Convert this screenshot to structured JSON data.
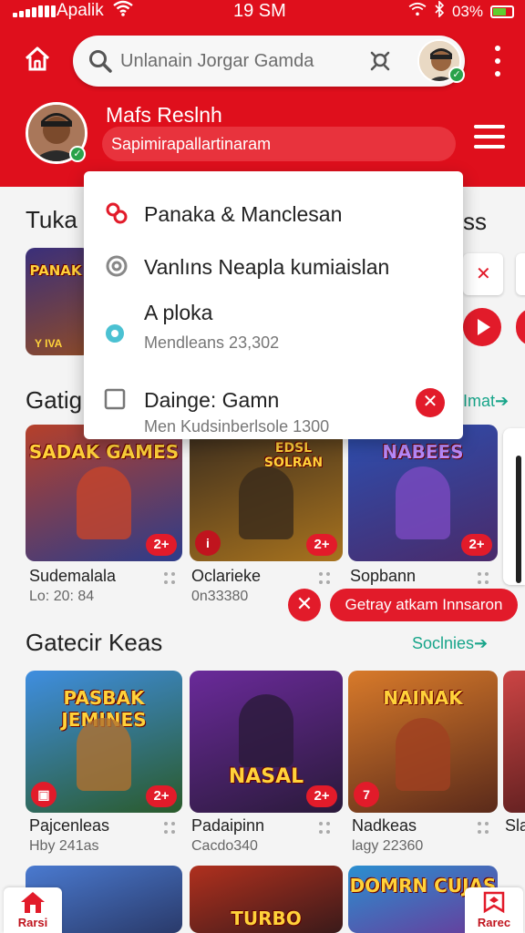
{
  "status_bar": {
    "carrier": "Apalik",
    "time": "19 SM",
    "battery": "03%"
  },
  "search": {
    "placeholder": "Unlanain Jorgar Gamda"
  },
  "profile": {
    "name": "Mafs Reslnh",
    "subtitle": "Sapimirapallartinaram"
  },
  "dropdown": {
    "items": [
      {
        "label": "Panaka &  Manclesan",
        "icon": "link-icon"
      },
      {
        "label": "Vanlıns Neapla kumiaislan",
        "icon": "refresh-icon"
      },
      {
        "label": "A ploka",
        "sub": "Mendleans 23,302",
        "icon": "radio-icon"
      },
      {
        "label": "Dainge: Gamn",
        "sub": "Men  Kudsinberlsole 1300",
        "icon": "checkbox-icon",
        "remove": "✕"
      }
    ]
  },
  "sections": [
    {
      "title": "Tuka",
      "title_right": "ss"
    },
    {
      "title": "Gatig",
      "link": "Imat➔"
    },
    {
      "title": "Gatecir Keas",
      "link": "Soclnies➔"
    }
  ],
  "tuka_tiles": [
    {
      "art": "PANAK",
      "caption": "Y  IVA"
    }
  ],
  "row1_games": [
    {
      "art": "SADAK GAMES",
      "title": "Sudemalala",
      "sub": "Lo: 20: 84",
      "badge": "2+",
      "accent": "#c7452a"
    },
    {
      "art": "EDSL SOLRAN",
      "title": "Oclarieke",
      "sub": "0n33380",
      "badge": "2+",
      "accent": "#6b4a2a"
    },
    {
      "art": "NABEES",
      "title": "Sopbann",
      "sub": "",
      "badge": "2+",
      "accent": "#3b4fa0"
    }
  ],
  "row2_games": [
    {
      "art": "PASBAK JEMINES",
      "title": "Pajcenleas",
      "sub": "Hby 241as",
      "badge": "2+",
      "accent": "#2a7fd0"
    },
    {
      "art": "NASAL",
      "title": "Padaipinn",
      "sub": "Cacdo340",
      "badge": "2+",
      "accent": "#7a2a9a"
    },
    {
      "art": "NAINAK",
      "title": "Nadkeas",
      "sub": "lagy 22360",
      "badge": "7",
      "accent": "#d86a1a"
    },
    {
      "art": "",
      "title": "Sla",
      "sub": "",
      "badge": "",
      "accent": "#c44"
    }
  ],
  "row3_games": [
    {
      "art": "",
      "accent": "#3a6fb0"
    },
    {
      "art": "TURBO",
      "accent": "#b0301e"
    },
    {
      "art": "DOMRN CUJAS",
      "accent": "#2a8fd0"
    }
  ],
  "toast": {
    "close": "✕",
    "text": "Getray atkam Innsaron"
  },
  "tuka_side_close": "✕",
  "bottom_nav": {
    "left": "Rarsi",
    "right": "Rarec"
  },
  "colors": {
    "brand_red": "#df0f1c",
    "accent_red": "#e21b2a",
    "link_green": "#18a58a"
  }
}
